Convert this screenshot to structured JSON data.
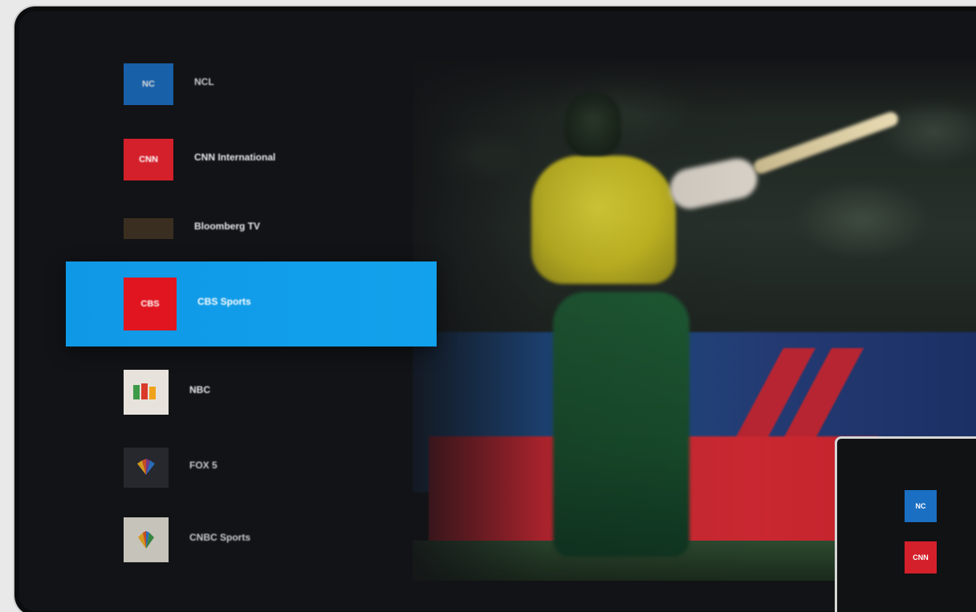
{
  "channels": [
    {
      "number": "",
      "logo": "NC",
      "logo_bg": "#1b6fc2",
      "name": "NCL",
      "sub": ""
    },
    {
      "number": "",
      "logo": "CNN",
      "logo_bg": "#d4202b",
      "name": "CNN International",
      "sub": ""
    },
    {
      "number": "",
      "logo": "",
      "logo_bg": "#3a2e20",
      "name": "Bloomberg TV",
      "sub": ""
    },
    {
      "number": "",
      "logo": "CBS",
      "logo_bg": "#e0151f",
      "name": "CBS Sports",
      "sub": ""
    },
    {
      "number": "",
      "logo": "",
      "logo_bg": "#e7e3dc",
      "name": "NBC",
      "sub": ""
    },
    {
      "number": "",
      "logo": "",
      "logo_bg": "#2a2c33",
      "name": "FOX 5",
      "sub": ""
    },
    {
      "number": "",
      "logo": "",
      "logo_bg": "#e6e2d8",
      "name": "CNBC Sports",
      "sub": ""
    }
  ],
  "selected_index": 3,
  "program": {
    "time": "",
    "title": "",
    "time2": ""
  },
  "pip": {
    "items": [
      {
        "logo": "NC",
        "logo_bg": "#1b6fc2",
        "name": ""
      },
      {
        "logo": "CNN",
        "logo_bg": "#d4202b",
        "name": ""
      }
    ]
  },
  "colors": {
    "selection": "#12a1ec",
    "background": "#121316"
  }
}
